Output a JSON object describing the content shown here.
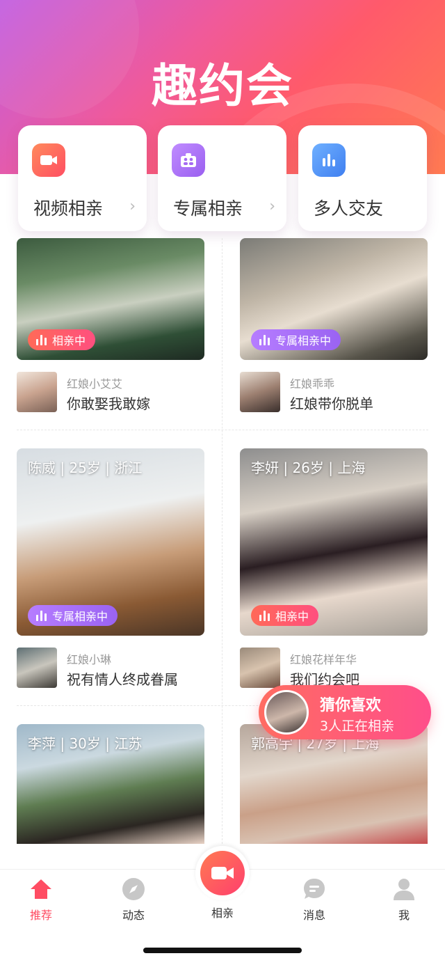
{
  "app": {
    "title": "趣约会"
  },
  "categories": [
    {
      "label": "视频相亲",
      "icon": "video-icon",
      "color": "#ff5a56"
    },
    {
      "label": "专属相亲",
      "icon": "couple-icon",
      "color": "#a56af2"
    },
    {
      "label": "多人交友",
      "icon": "bar-chart-icon",
      "color": "#4a8ef5"
    }
  ],
  "rooms": [
    {
      "caption": "",
      "badge": "相亲中",
      "badge_type": "red",
      "matchmaker": "红娘小艾艾",
      "slogan": "你敢娶我敢嫁"
    },
    {
      "caption": "",
      "badge": "专属相亲中",
      "badge_type": "purple",
      "matchmaker": "红娘乖乖",
      "slogan": "红娘带你脱单"
    },
    {
      "caption": "陈威 | 25岁 | 浙江",
      "badge": "专属相亲中",
      "badge_type": "purple",
      "matchmaker": "红娘小琳",
      "slogan": "祝有情人终成眷属"
    },
    {
      "caption": "李妍 | 26岁 | 上海",
      "badge": "相亲中",
      "badge_type": "red",
      "matchmaker": "红娘花样年华",
      "slogan": "我们约会吧"
    },
    {
      "caption": "李萍 | 30岁 | 江苏",
      "badge": "",
      "badge_type": "",
      "matchmaker": "",
      "slogan": ""
    },
    {
      "caption": "郭高宇 | 27岁 | 上海",
      "badge": "",
      "badge_type": "",
      "matchmaker": "",
      "slogan": ""
    }
  ],
  "guess": {
    "title": "猜你喜欢",
    "subtitle": "3人正在相亲"
  },
  "tabs": [
    {
      "label": "推荐",
      "icon": "home-icon",
      "active": true
    },
    {
      "label": "动态",
      "icon": "compass-icon",
      "active": false
    },
    {
      "label": "相亲",
      "icon": "video-camera-icon",
      "active": false
    },
    {
      "label": "消息",
      "icon": "chat-icon",
      "active": false
    },
    {
      "label": "我",
      "icon": "user-icon",
      "active": false
    }
  ],
  "colors": {
    "accent": "#ff4d63",
    "purple": "#a56af2",
    "blue": "#4a8ef5"
  }
}
